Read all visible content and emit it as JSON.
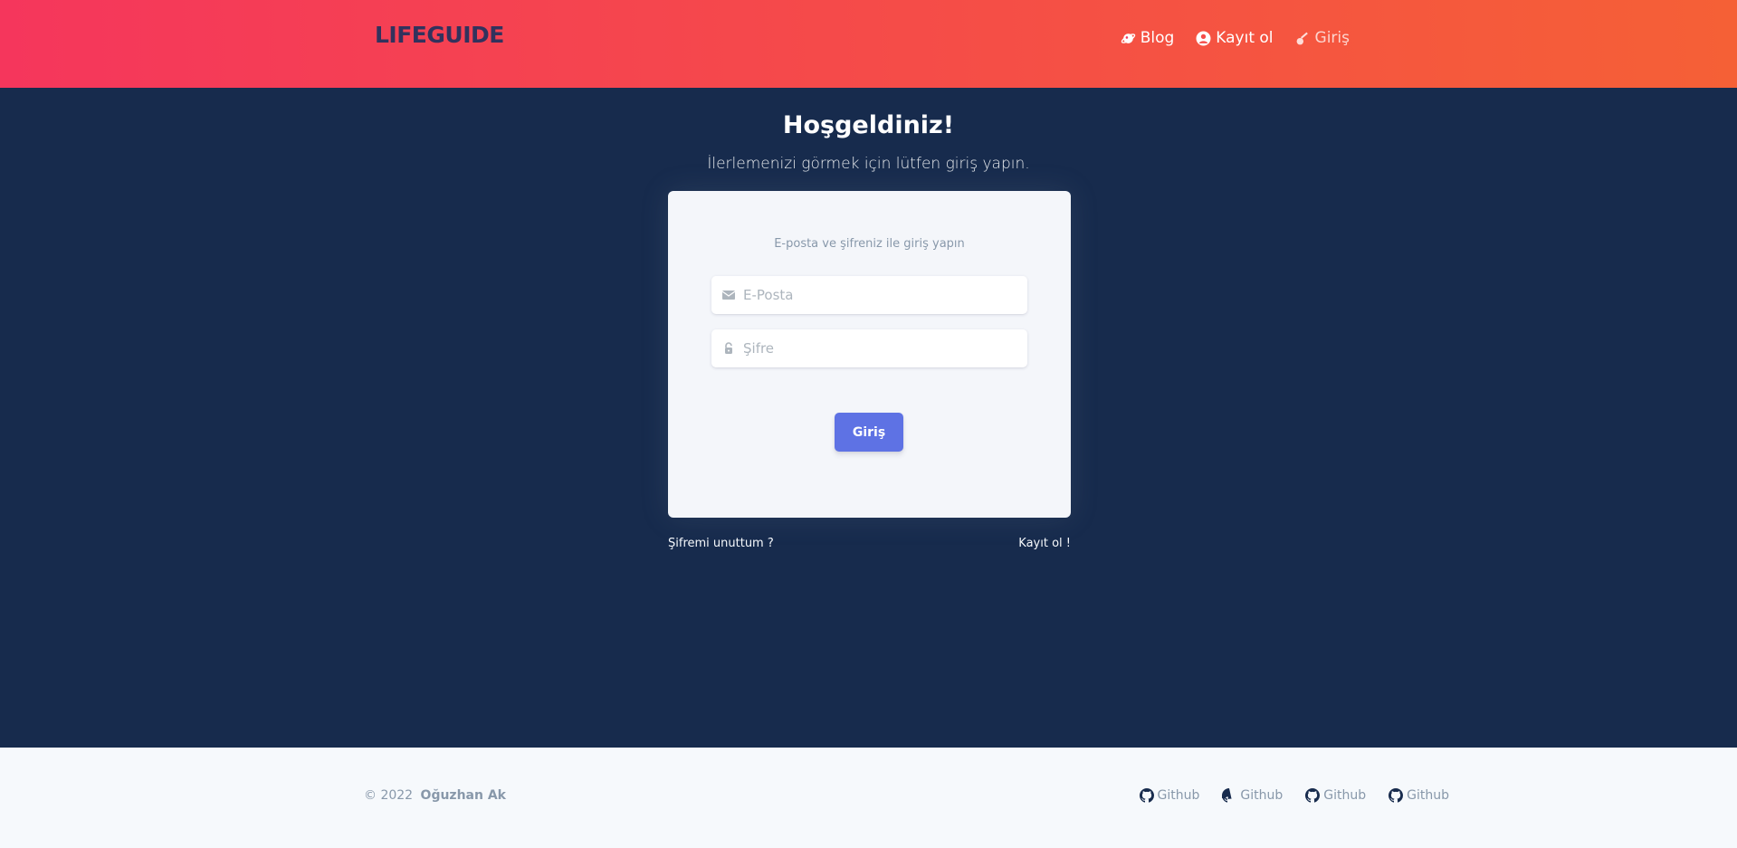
{
  "navbar": {
    "brand": "LIFEGUIDE",
    "links": [
      {
        "label": "Blog",
        "icon": "planet-icon"
      },
      {
        "label": "Kayıt ol",
        "icon": "user-circle-icon"
      },
      {
        "label": "Giriş",
        "icon": "key-icon"
      }
    ]
  },
  "main": {
    "title": "Hoşgeldiniz!",
    "subtitle": "İlerlemenizi görmek için lütfen giriş yapın."
  },
  "login_card": {
    "hint": "E-posta ve şifreniz ile giriş yapın",
    "email_placeholder": "E-Posta",
    "password_placeholder": "Şifre",
    "submit_label": "Giriş"
  },
  "links": {
    "forgot_password": "Şifremi unuttum ?",
    "register": "Kayıt ol !"
  },
  "footer": {
    "year": "© 2022",
    "author": "Oğuzhan Ak",
    "links": [
      {
        "label": "Github",
        "icon": "github-icon"
      },
      {
        "label": "Github",
        "icon": "github-icon"
      },
      {
        "label": "Github",
        "icon": "github-icon"
      },
      {
        "label": "Github",
        "icon": "github-icon"
      }
    ]
  },
  "colors": {
    "gradient_start": "#f5365c",
    "gradient_end": "#f56036",
    "background": "#172b4d",
    "primary_button": "#5e72e4",
    "card": "#f4f6fa",
    "footer": "#f6f9fc"
  }
}
